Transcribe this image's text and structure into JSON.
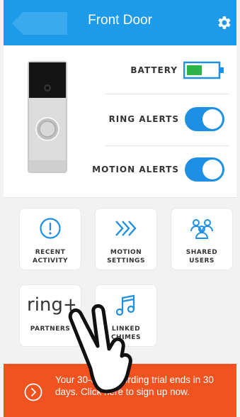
{
  "header": {
    "title": "Front Door",
    "back_icon": "back-arrow-icon",
    "settings_icon": "gear-icon"
  },
  "status": {
    "battery_label": "BATTERY",
    "battery_level": 0.5,
    "ring_alerts_label": "RING ALERTS",
    "ring_alerts_on": true,
    "motion_alerts_label": "MOTION ALERTS",
    "motion_alerts_on": true
  },
  "tiles": [
    {
      "label": "RECENT\nACTIVITY",
      "icon": "alert-circle-icon"
    },
    {
      "label": "MOTION\nSETTINGS",
      "icon": "motion-chevrons-icon"
    },
    {
      "label": "SHARED\nUSERS",
      "icon": "users-icon"
    },
    {
      "label": "PARTNERS",
      "icon": "ring-plus-logo",
      "logo_text": "ring+"
    },
    {
      "label": "LINKED\nCHIMES",
      "icon": "music-note-icon"
    }
  ],
  "banner": {
    "text": "Your 30-day recording trial ends in 30 days. Click here to sign up now.",
    "icon": "chevron-right-circle-icon"
  },
  "colors": {
    "primary": "#1e9be8",
    "toggle": "#1e8fe3",
    "banner": "#f0531f",
    "battery": "#2db34a"
  }
}
